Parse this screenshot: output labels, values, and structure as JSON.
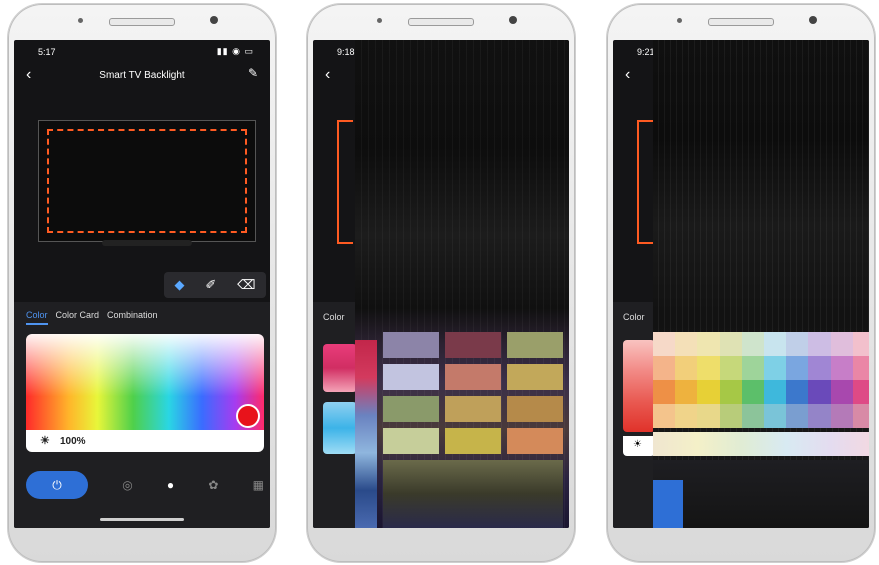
{
  "phones": [
    {
      "time": "5:17"
    },
    {
      "time": "9:18"
    },
    {
      "time": "9:21"
    }
  ],
  "app": {
    "title": "Smart TV Backlight",
    "back_icon": "chevron-left-icon",
    "edit_icon": "pencil-icon"
  },
  "tools": [
    "brush-icon",
    "paint-icon",
    "eraser-icon"
  ],
  "tabs": [
    {
      "label": "Color",
      "active": true
    },
    {
      "label": "Color Card",
      "active": false
    },
    {
      "label": "Combination",
      "active": false
    }
  ],
  "brightness": {
    "label": "100%",
    "value": 1.0
  },
  "nav": [
    "power-icon",
    "palette-icon",
    "bulb-icon",
    "scene-icon",
    "grid-icon"
  ],
  "colors": {
    "accent": "#2e6fd6",
    "strip": "#ff5b22",
    "selected": "#e8131b"
  },
  "second_phone": {
    "tab_label": "Color"
  },
  "third_phone": {
    "tab_label": "Color"
  }
}
